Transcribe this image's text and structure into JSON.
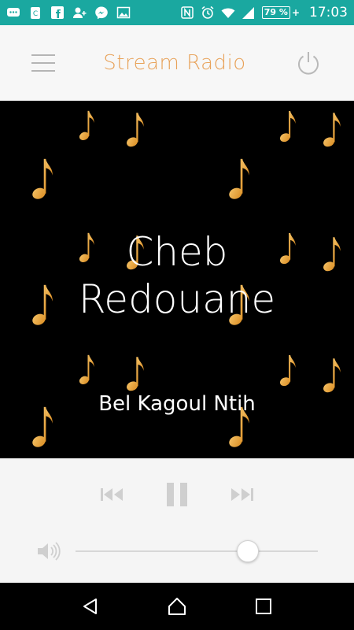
{
  "status_bar": {
    "battery_text": "79 %",
    "battery_charging": "+",
    "clock": "17:03",
    "left_icons": [
      "chat-icon",
      "clipboard-icon",
      "facebook-icon",
      "add-contact-icon",
      "messenger-icon",
      "image-icon"
    ],
    "right_icons": [
      "nfc-icon",
      "alarm-icon",
      "wifi-icon",
      "signal-icon",
      "battery-icon"
    ],
    "background": "#1aa8a0"
  },
  "header": {
    "title": "Stream Radio",
    "title_color": "#e8a259"
  },
  "now_playing": {
    "artist_line1": "Cheb",
    "artist_line2": "Redouane",
    "track": "Bel Kagoul Ntih",
    "background_art": "music-notes-pattern",
    "note_color": "#d98a1f"
  },
  "controls": {
    "icons": [
      "previous-icon",
      "pause-icon",
      "next-icon"
    ],
    "volume_level": 0.71,
    "volume_icon": "speaker-icon"
  },
  "nav_bar": {
    "icons": [
      "back-icon",
      "home-icon",
      "recents-icon"
    ]
  }
}
